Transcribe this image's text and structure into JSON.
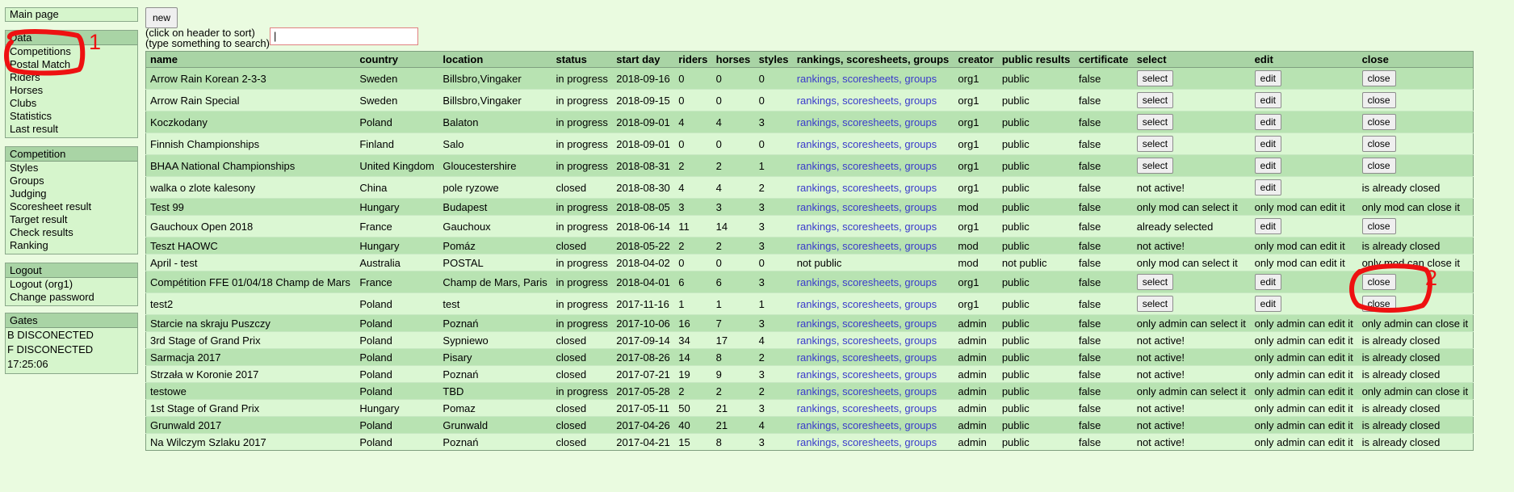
{
  "sidebar": {
    "main_page": "Main page",
    "data_box": {
      "header": "Data",
      "items": [
        "Competitions",
        "Postal Match",
        "Riders",
        "Horses",
        "Clubs",
        "Statistics",
        "Last result"
      ]
    },
    "competition_box": {
      "header": "Competition",
      "items": [
        "Styles",
        "Groups",
        "Judging",
        "Scoresheet result",
        "Target result",
        "Check results",
        "Ranking"
      ]
    },
    "logout_box": {
      "header": "Logout",
      "items": [
        "Logout (org1)",
        "Change password"
      ]
    },
    "gates_box": {
      "header": "Gates",
      "items": [
        "B DISCONECTED",
        "F DISCONECTED",
        "17:25:06"
      ]
    }
  },
  "toolbar": {
    "new_label": "new",
    "hint_sort": "(click on header to sort)",
    "hint_type": "(type something to search)",
    "search_value": "|"
  },
  "table": {
    "headers": [
      "name",
      "country",
      "location",
      "status",
      "start day",
      "riders",
      "horses",
      "styles",
      "rankings, scoresheets, groups",
      "creator",
      "public results",
      "certificate",
      "select",
      "edit",
      "close"
    ],
    "rows": [
      {
        "name": "Arrow Rain Korean 2-3-3",
        "country": "Sweden",
        "location": "Billsbro,Vingaker",
        "status": "in progress",
        "start": "2018-09-16",
        "riders": "0",
        "horses": "0",
        "styles": "0",
        "links": "rankings, scoresheets, groups",
        "creator": "org1",
        "public": "public",
        "cert": "false",
        "select": "select",
        "edit": "edit",
        "close": "close"
      },
      {
        "name": "Arrow Rain Special",
        "country": "Sweden",
        "location": "Billsbro,Vingaker",
        "status": "in progress",
        "start": "2018-09-15",
        "riders": "0",
        "horses": "0",
        "styles": "0",
        "links": "rankings, scoresheets, groups",
        "creator": "org1",
        "public": "public",
        "cert": "false",
        "select": "select",
        "edit": "edit",
        "close": "close"
      },
      {
        "name": "Koczkodany",
        "country": "Poland",
        "location": "Balaton",
        "status": "in progress",
        "start": "2018-09-01",
        "riders": "4",
        "horses": "4",
        "styles": "3",
        "links": "rankings, scoresheets, groups",
        "creator": "org1",
        "public": "public",
        "cert": "false",
        "select": "select",
        "edit": "edit",
        "close": "close"
      },
      {
        "name": "Finnish Championships",
        "country": "Finland",
        "location": "Salo",
        "status": "in progress",
        "start": "2018-09-01",
        "riders": "0",
        "horses": "0",
        "styles": "0",
        "links": "rankings, scoresheets, groups",
        "creator": "org1",
        "public": "public",
        "cert": "false",
        "select": "select",
        "edit": "edit",
        "close": "close"
      },
      {
        "name": "BHAA National Championships",
        "country": "United Kingdom",
        "location": "Gloucestershire",
        "status": "in progress",
        "start": "2018-08-31",
        "riders": "2",
        "horses": "2",
        "styles": "1",
        "links": "rankings, scoresheets, groups",
        "creator": "org1",
        "public": "public",
        "cert": "false",
        "select": "select",
        "edit": "edit",
        "close": "close"
      },
      {
        "name": "walka o zlote kalesony",
        "country": "China",
        "location": "pole ryzowe",
        "status": "closed",
        "start": "2018-08-30",
        "riders": "4",
        "horses": "4",
        "styles": "2",
        "links": "rankings, scoresheets, groups",
        "creator": "org1",
        "public": "public",
        "cert": "false",
        "select": "not active!",
        "edit": "edit",
        "close": "is already closed"
      },
      {
        "name": "Test 99",
        "country": "Hungary",
        "location": "Budapest",
        "status": "in progress",
        "start": "2018-08-05",
        "riders": "3",
        "horses": "3",
        "styles": "3",
        "links": "rankings, scoresheets, groups",
        "creator": "mod",
        "public": "public",
        "cert": "false",
        "select": "only mod can select it",
        "edit": "only mod can edit it",
        "close": "only mod can close it"
      },
      {
        "name": "Gauchoux Open 2018",
        "country": "France",
        "location": "Gauchoux",
        "status": "in progress",
        "start": "2018-06-14",
        "riders": "11",
        "horses": "14",
        "styles": "3",
        "links": "rankings, scoresheets, groups",
        "creator": "org1",
        "public": "public",
        "cert": "false",
        "select": "already selected",
        "edit": "edit",
        "close": "close"
      },
      {
        "name": "Teszt HAOWC",
        "country": "Hungary",
        "location": "Pomáz",
        "status": "closed",
        "start": "2018-05-22",
        "riders": "2",
        "horses": "2",
        "styles": "3",
        "links": "rankings, scoresheets, groups",
        "creator": "mod",
        "public": "public",
        "cert": "false",
        "select": "not active!",
        "edit": "only mod can edit it",
        "close": "is already closed"
      },
      {
        "name": "April - test",
        "country": "Australia",
        "location": "POSTAL",
        "status": "in progress",
        "start": "2018-04-02",
        "riders": "0",
        "horses": "0",
        "styles": "0",
        "links": "not public",
        "creator": "mod",
        "public": "not public",
        "cert": "false",
        "select": "only mod can select it",
        "edit": "only mod can edit it",
        "close": "only mod can close it"
      },
      {
        "name": "Compétition FFE 01/04/18 Champ de Mars",
        "country": "France",
        "location": "Champ de Mars, Paris",
        "status": "in progress",
        "start": "2018-04-01",
        "riders": "6",
        "horses": "6",
        "styles": "3",
        "links": "rankings, scoresheets, groups",
        "creator": "org1",
        "public": "public",
        "cert": "false",
        "select": "select",
        "edit": "edit",
        "close": "close"
      },
      {
        "name": "test2",
        "country": "Poland",
        "location": "test",
        "status": "in progress",
        "start": "2017-11-16",
        "riders": "1",
        "horses": "1",
        "styles": "1",
        "links": "rankings, scoresheets, groups",
        "creator": "org1",
        "public": "public",
        "cert": "false",
        "select": "select",
        "edit": "edit",
        "close": "close"
      },
      {
        "name": "Starcie na skraju Puszczy",
        "country": "Poland",
        "location": "Poznań",
        "status": "in progress",
        "start": "2017-10-06",
        "riders": "16",
        "horses": "7",
        "styles": "3",
        "links": "rankings, scoresheets, groups",
        "creator": "admin",
        "public": "public",
        "cert": "false",
        "select": "only admin can select it",
        "edit": "only admin can edit it",
        "close": "only admin can close it"
      },
      {
        "name": "3rd Stage of Grand Prix",
        "country": "Poland",
        "location": "Sypniewo",
        "status": "closed",
        "start": "2017-09-14",
        "riders": "34",
        "horses": "17",
        "styles": "4",
        "links": "rankings, scoresheets, groups",
        "creator": "admin",
        "public": "public",
        "cert": "false",
        "select": "not active!",
        "edit": "only admin can edit it",
        "close": "is already closed"
      },
      {
        "name": "Sarmacja 2017",
        "country": "Poland",
        "location": "Pisary",
        "status": "closed",
        "start": "2017-08-26",
        "riders": "14",
        "horses": "8",
        "styles": "2",
        "links": "rankings, scoresheets, groups",
        "creator": "admin",
        "public": "public",
        "cert": "false",
        "select": "not active!",
        "edit": "only admin can edit it",
        "close": "is already closed"
      },
      {
        "name": "Strzała w Koronie 2017",
        "country": "Poland",
        "location": "Poznań",
        "status": "closed",
        "start": "2017-07-21",
        "riders": "19",
        "horses": "9",
        "styles": "3",
        "links": "rankings, scoresheets, groups",
        "creator": "admin",
        "public": "public",
        "cert": "false",
        "select": "not active!",
        "edit": "only admin can edit it",
        "close": "is already closed"
      },
      {
        "name": "testowe",
        "country": "Poland",
        "location": "TBD",
        "status": "in progress",
        "start": "2017-05-28",
        "riders": "2",
        "horses": "2",
        "styles": "2",
        "links": "rankings, scoresheets, groups",
        "creator": "admin",
        "public": "public",
        "cert": "false",
        "select": "only admin can select it",
        "edit": "only admin can edit it",
        "close": "only admin can close it"
      },
      {
        "name": "1st Stage of Grand Prix",
        "country": "Hungary",
        "location": "Pomaz",
        "status": "closed",
        "start": "2017-05-11",
        "riders": "50",
        "horses": "21",
        "styles": "3",
        "links": "rankings, scoresheets, groups",
        "creator": "admin",
        "public": "public",
        "cert": "false",
        "select": "not active!",
        "edit": "only admin can edit it",
        "close": "is already closed"
      },
      {
        "name": "Grunwald 2017",
        "country": "Poland",
        "location": "Grunwald",
        "status": "closed",
        "start": "2017-04-26",
        "riders": "40",
        "horses": "21",
        "styles": "4",
        "links": "rankings, scoresheets, groups",
        "creator": "admin",
        "public": "public",
        "cert": "false",
        "select": "not active!",
        "edit": "only admin can edit it",
        "close": "is already closed"
      },
      {
        "name": "Na Wilczym Szlaku 2017",
        "country": "Poland",
        "location": "Poznań",
        "status": "closed",
        "start": "2017-04-21",
        "riders": "15",
        "horses": "8",
        "styles": "3",
        "links": "rankings, scoresheets, groups",
        "creator": "admin",
        "public": "public",
        "cert": "false",
        "select": "not active!",
        "edit": "only admin can edit it",
        "close": "is already closed"
      }
    ]
  },
  "annotations": {
    "color": "#e11",
    "label_1": "1",
    "label_2": "2"
  }
}
